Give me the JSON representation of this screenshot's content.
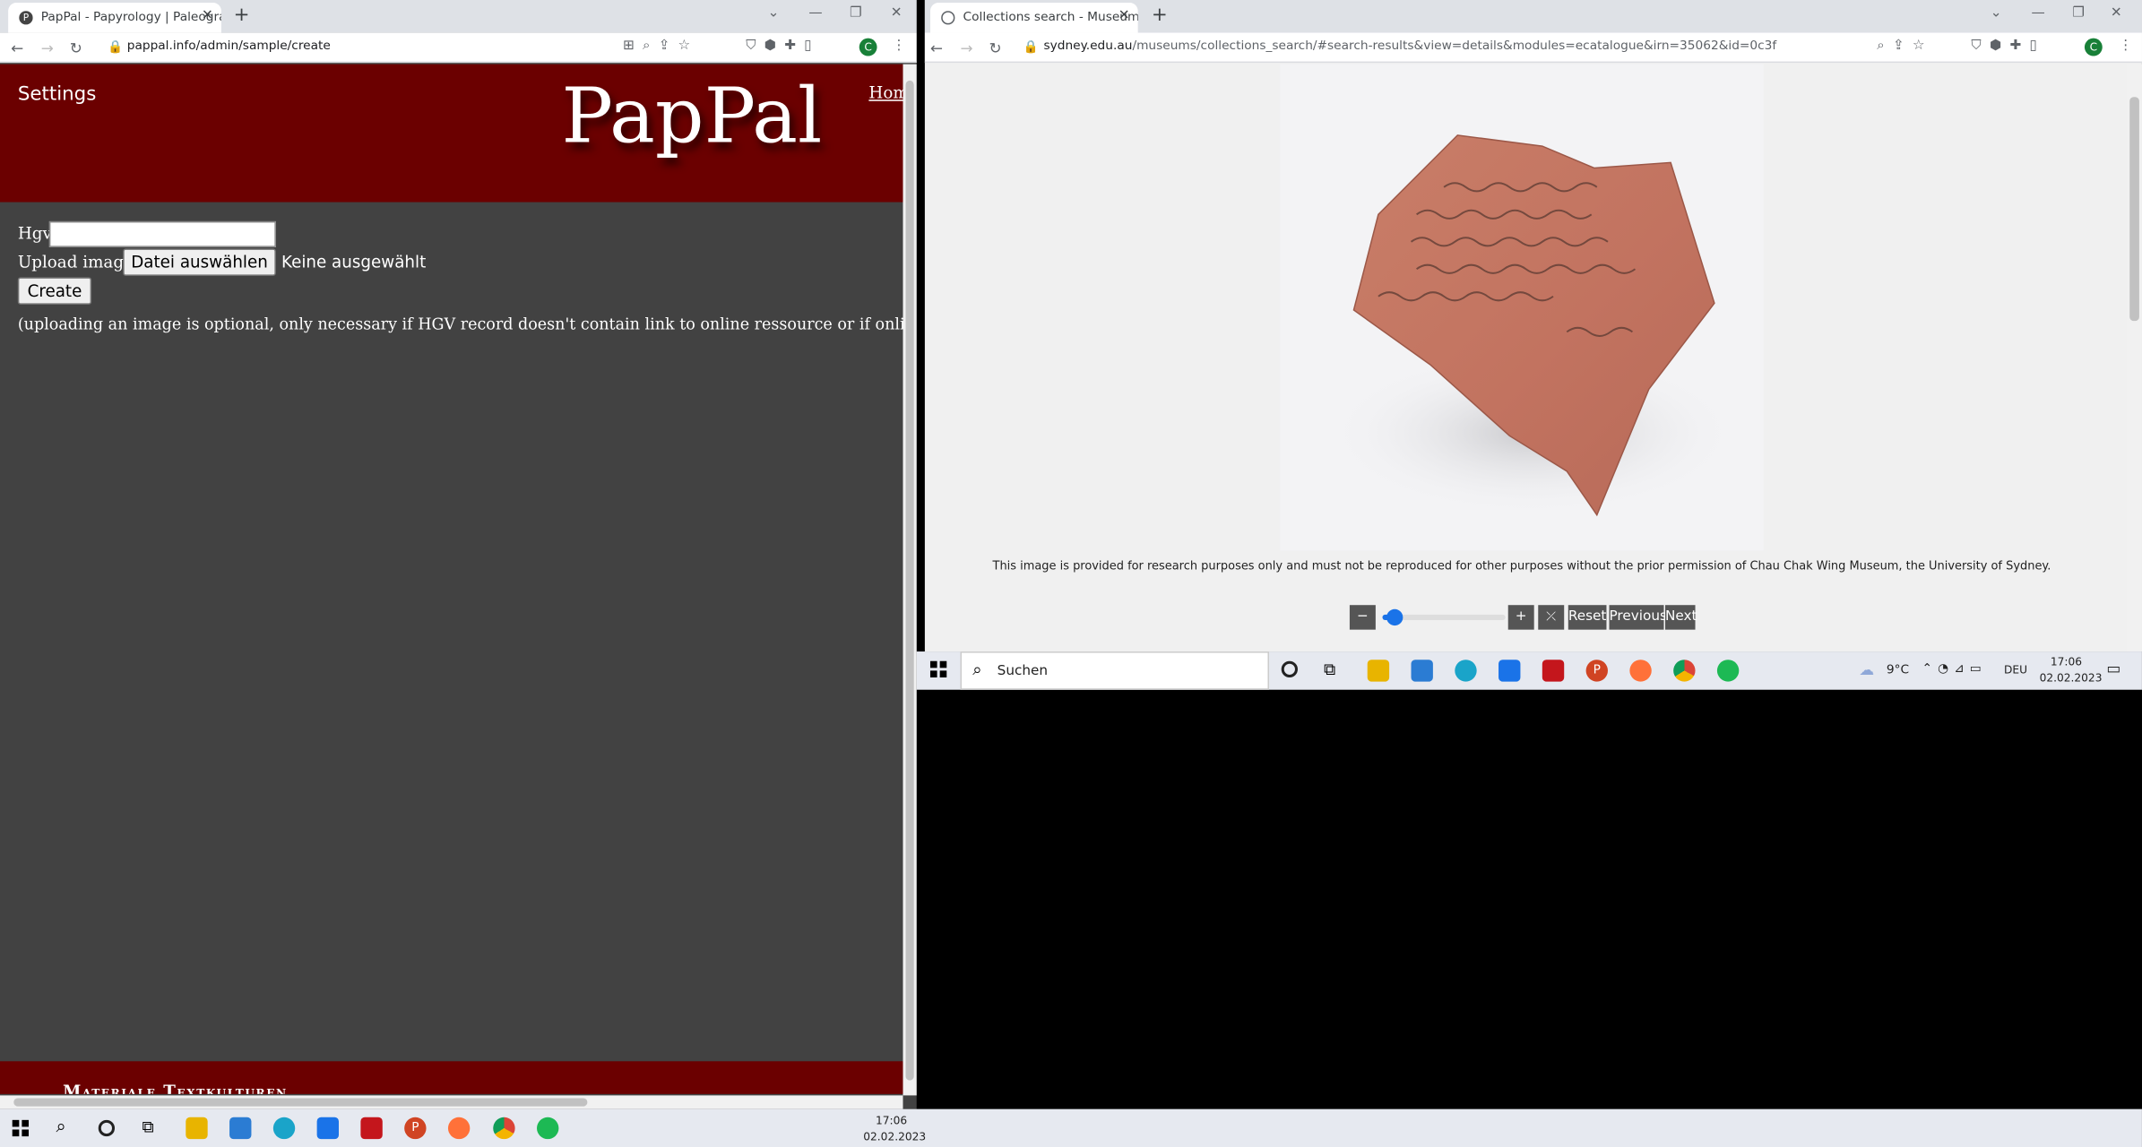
{
  "left": {
    "tab_title": "PapPal - Papyrology | Paleograph",
    "url": "pappal.info/admin/sample/create",
    "settings": "Settings",
    "logo": "PapPal",
    "home": "Hom",
    "hgv_label": "Hgv",
    "hgv_value": "",
    "upload_label": "Upload image",
    "choose_file": "Datei auswählen",
    "no_file": "Keine ausgewählt",
    "create": "Create",
    "note": "(uploading an image is optional, only necessary if HGV record doesn't contain link to online ressource or if online arc",
    "footer": "Materiale Textkulturen",
    "header_color": "#6b0000",
    "content_bg": "#424242"
  },
  "right": {
    "tab_title": "Collections search - Museums - T",
    "url_host": "sydney.edu.au",
    "url_path": "/museums/collections_search/#search-results&view=details&modules=ecatalogue&irn=35062&id=0c3f",
    "disclaimer": "This image is provided for research purposes only and must not be reproduced for other purposes without the prior permission of Chau Chak Wing Museum, the University of Sydney.",
    "zoom_out": "−",
    "zoom_in": "+",
    "zoom_level": 0.1,
    "fullscreen": "⤫",
    "reset": "Reset",
    "previous": "Previous",
    "next": "Next"
  },
  "inner_taskbar": {
    "search": "Suchen",
    "weather": "9°C",
    "lang": "DEU",
    "time": "17:06",
    "date": "02.02.2023"
  },
  "taskbar": {
    "time": "17:06",
    "date": "02.02.2023"
  }
}
